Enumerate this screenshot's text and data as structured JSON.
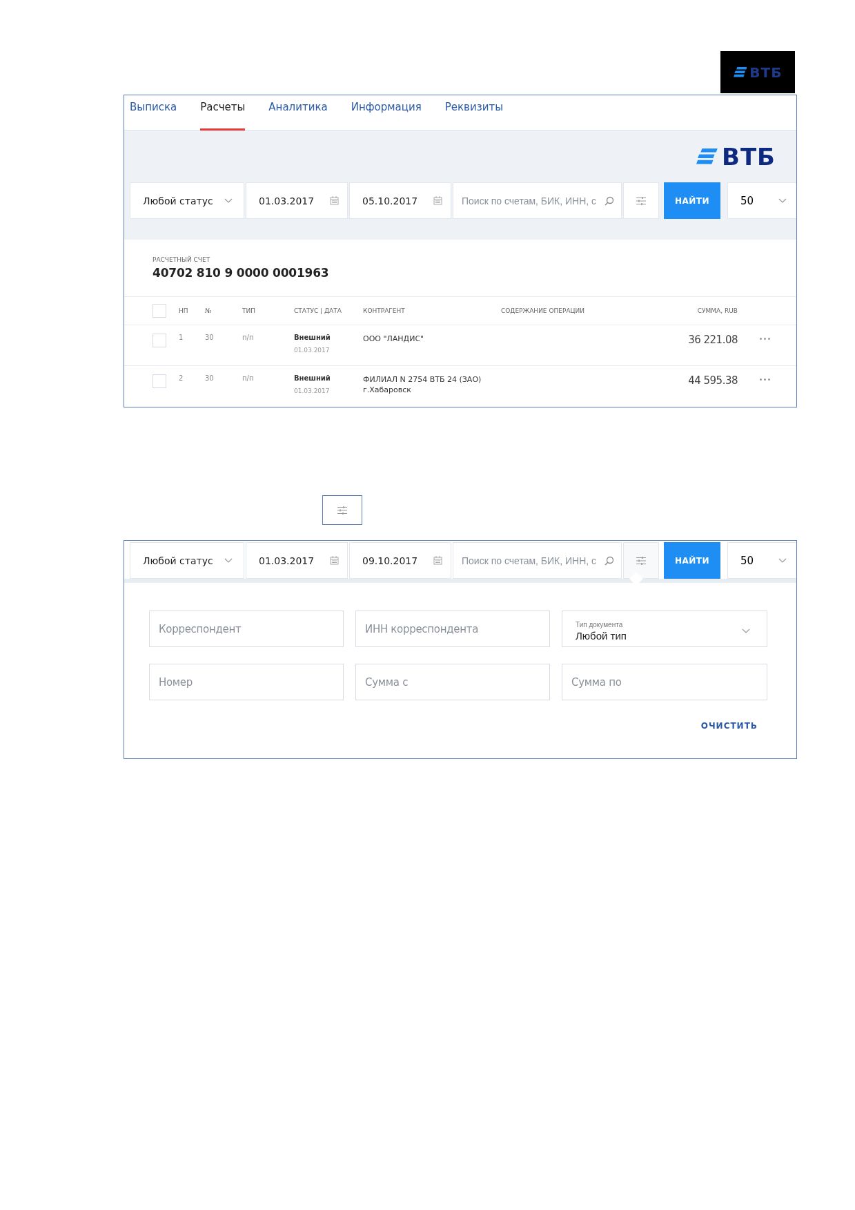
{
  "top_logo": {
    "text": "ВТБ"
  },
  "panel": {
    "tabs": [
      {
        "label": "Выписка",
        "selected": false
      },
      {
        "label": "Расчеты",
        "selected": true
      },
      {
        "label": "Аналитика",
        "selected": false
      },
      {
        "label": "Информация",
        "selected": false
      },
      {
        "label": "Реквизиты",
        "selected": false
      }
    ],
    "logo": {
      "text": "ВТБ"
    },
    "filter_bar": {
      "status": "Любой статус",
      "date_from": "01.03.2017",
      "date_to": "05.10.2017",
      "search_placeholder": "Поиск по счетам, БИК, ИНН, с",
      "filters_expanded": false,
      "find_button": "НАЙТИ",
      "page_size": "50"
    },
    "account": {
      "label": "РАСЧЕТНЫЙ СЧЕТ",
      "number": "40702 810 9 0000 0001963"
    },
    "table": {
      "select_all_checked": false,
      "columns": [
        "НП",
        "№",
        "ТИП",
        "СТАТУС | ДАТА",
        "КОНТРАГЕНТ",
        "СОДЕРЖАНИЕ ОПЕРАЦИИ",
        "СУММА, RUB"
      ],
      "rows": [
        {
          "checked": false,
          "np": "1",
          "number": "30",
          "type": "п/п",
          "status": "Внешний",
          "date": "01.03.2017",
          "counterparty": [
            "ООО \"ЛАНДИС\""
          ],
          "amount": "36 221.08"
        },
        {
          "checked": false,
          "np": "2",
          "number": "30",
          "type": "п/п",
          "status": "Внешний",
          "date": "01.03.2017",
          "counterparty": [
            "ФИЛИАЛ N 2754 ВТБ 24 (ЗАО)",
            "г.Хабаровск"
          ],
          "amount": "44 595.38"
        }
      ]
    }
  },
  "filter_panel": {
    "filter_bar": {
      "status": "Любой статус",
      "date_from": "01.03.2017",
      "date_to": "09.10.2017",
      "search_placeholder": "Поиск по счетам, БИК, ИНН, с",
      "filters_expanded": true,
      "find_button": "НАЙТИ",
      "page_size": "50"
    },
    "fields": [
      {
        "kind": "input",
        "placeholder": "Корреспондент"
      },
      {
        "kind": "input",
        "placeholder": "ИНН корреспондента"
      },
      {
        "kind": "select",
        "label": "Тип документа",
        "value": "Любой тип"
      },
      {
        "kind": "input",
        "placeholder": "Номер"
      },
      {
        "kind": "input",
        "placeholder": "Сумма с"
      },
      {
        "kind": "input",
        "placeholder": "Сумма по"
      }
    ],
    "clear_button": "ОЧИСТИТЬ"
  }
}
